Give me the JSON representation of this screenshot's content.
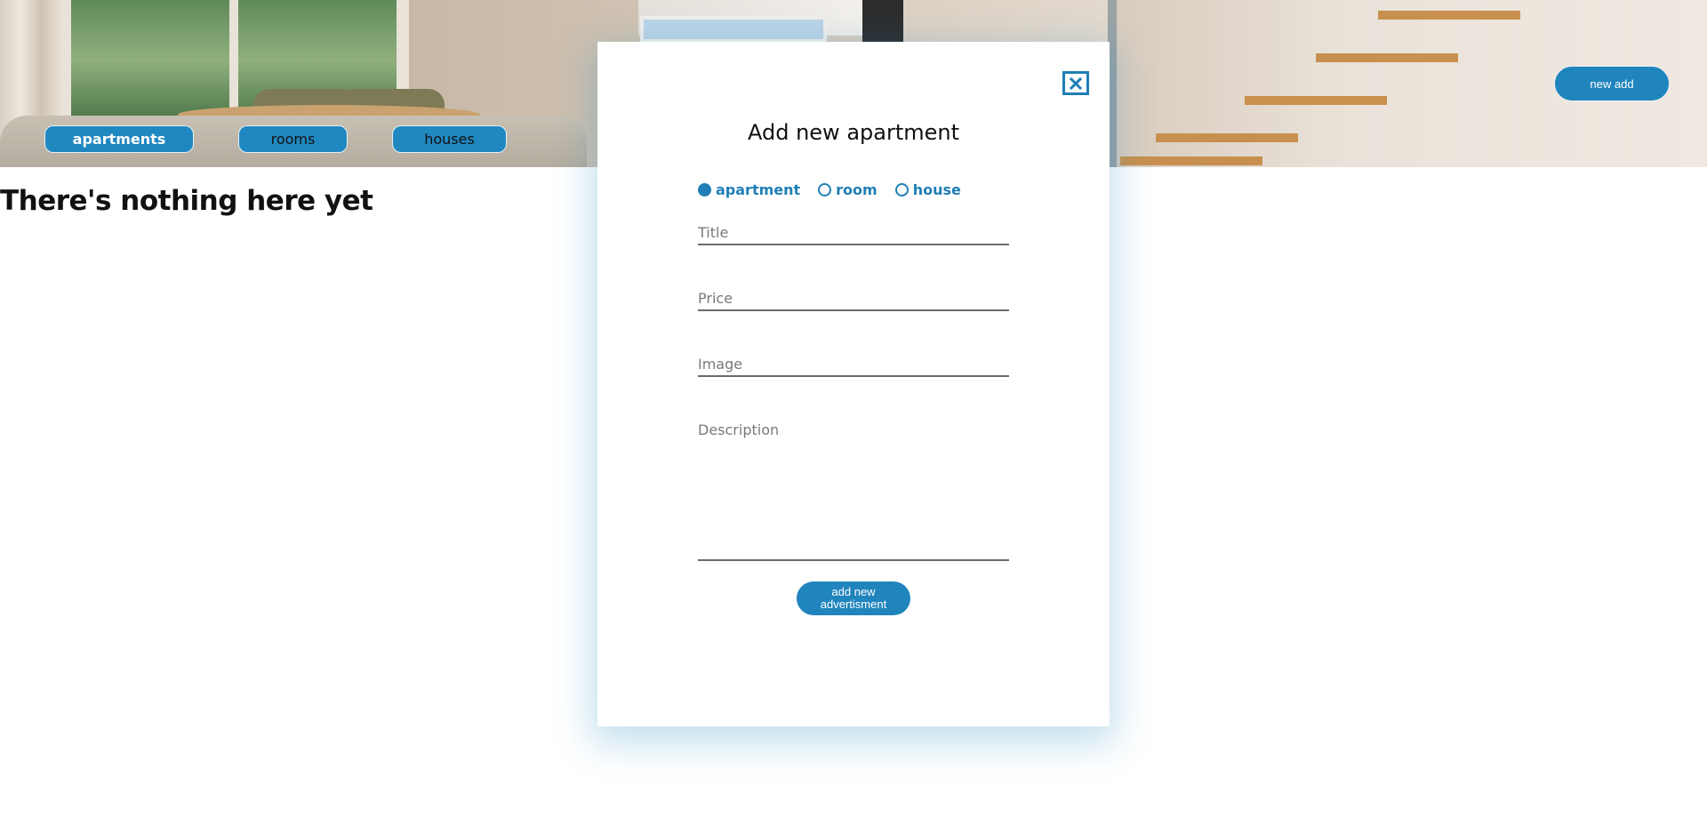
{
  "nav": {
    "items": [
      {
        "label": "apartments",
        "active": true
      },
      {
        "label": "rooms",
        "active": false
      },
      {
        "label": "houses",
        "active": false
      }
    ]
  },
  "header": {
    "new_add_label": "new add"
  },
  "main": {
    "empty_message": "There's nothing here yet"
  },
  "modal": {
    "title": "Add new apartment",
    "close_icon": "close-icon",
    "types": [
      {
        "label": "apartment",
        "checked": true
      },
      {
        "label": "room",
        "checked": false
      },
      {
        "label": "house",
        "checked": false
      }
    ],
    "fields": {
      "title_placeholder": "Title",
      "price_placeholder": "Price",
      "image_placeholder": "Image",
      "description_placeholder": "Description"
    },
    "submit_label": "add new advertisment"
  },
  "colors": {
    "accent": "#2088c0",
    "text": "#111111"
  }
}
